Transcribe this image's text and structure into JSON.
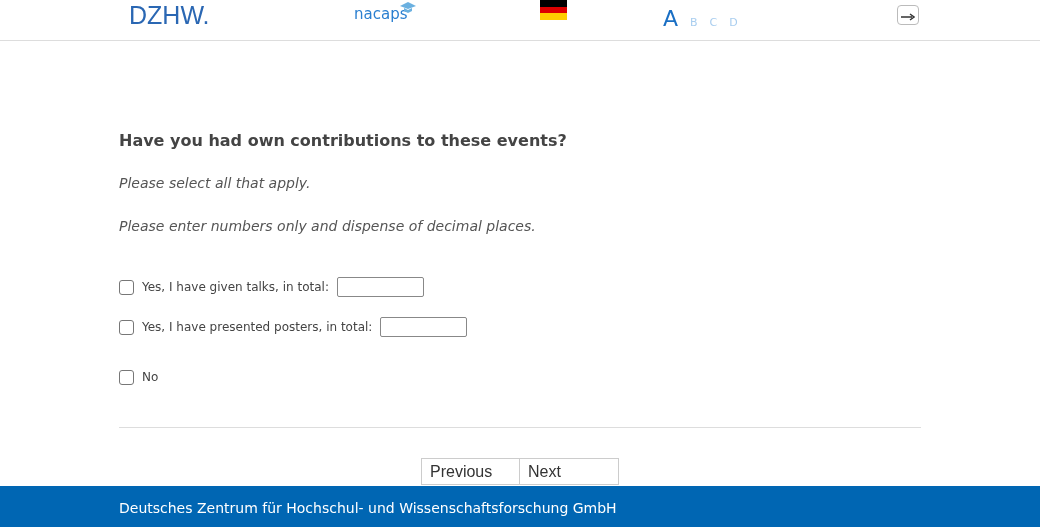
{
  "header": {
    "logo": "DZHW.",
    "brand": "nacaps",
    "font_sizes": [
      {
        "label": "A",
        "selected": true
      },
      {
        "label": "B",
        "selected": false
      },
      {
        "label": "C",
        "selected": false
      },
      {
        "label": "D",
        "selected": false
      }
    ]
  },
  "question": {
    "title": "Have you had own contributions to these events?",
    "hints": [
      "Please select all that apply.",
      "Please enter numbers only and dispense of decimal places."
    ],
    "options": [
      {
        "kind": "with_input",
        "label": "Yes, I have given talks, in total:",
        "checked": false
      },
      {
        "kind": "with_input",
        "label": "Yes, I have presented posters, in total:",
        "checked": false
      },
      {
        "kind": "plain",
        "label": "No",
        "checked": false
      }
    ]
  },
  "buttons": [
    "Previous",
    "Next"
  ],
  "footer": "Deutsches Zentrum für Hochschul- und Wissenschaftsforschung GmbH"
}
